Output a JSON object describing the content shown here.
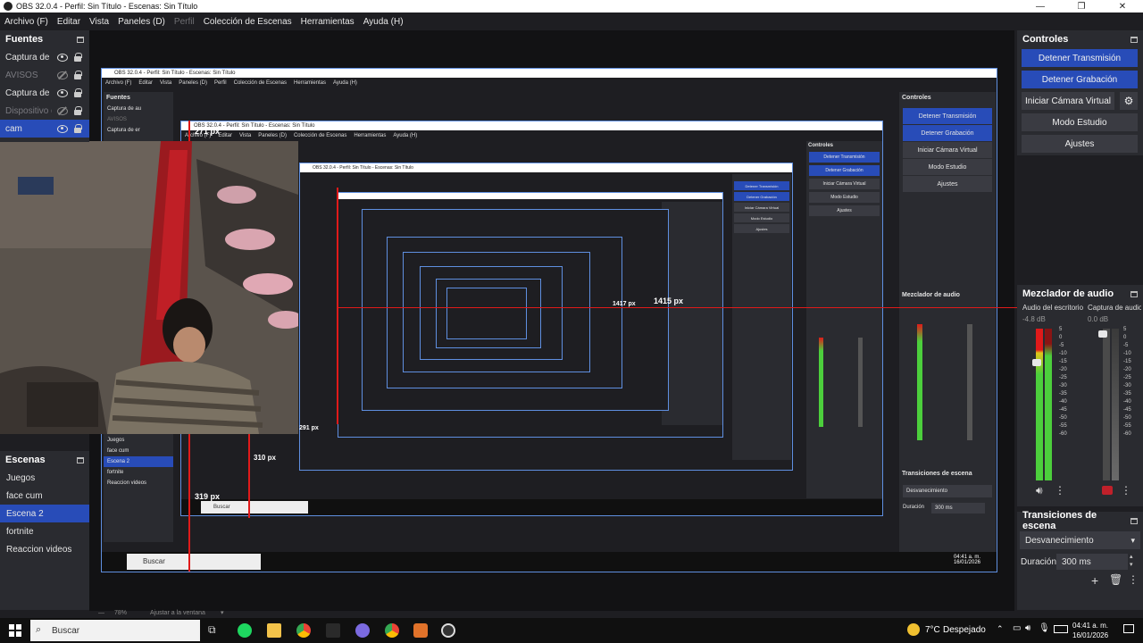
{
  "window": {
    "title": "OBS 32.0.4 - Perfil: Sin Título - Escenas: Sin Título",
    "ctrl_min": "—",
    "ctrl_max": "❐",
    "ctrl_close": "✕"
  },
  "menu": {
    "items": [
      "Archivo (F)",
      "Editar",
      "Vista",
      "Paneles (D)",
      "Perfil",
      "Colección de Escenas",
      "Herramientas",
      "Ayuda (H)"
    ]
  },
  "sources": {
    "title": "Fuentes",
    "items": [
      {
        "label": "Captura de au",
        "visible": true,
        "selected": false
      },
      {
        "label": "AVISOS",
        "visible": false,
        "selected": false
      },
      {
        "label": "Captura de er",
        "visible": true,
        "selected": false
      },
      {
        "label": "Dispositivo de",
        "visible": false,
        "selected": false
      },
      {
        "label": "cam",
        "visible": true,
        "selected": true
      }
    ]
  },
  "scenes": {
    "title": "Escenas",
    "items": [
      "Juegos",
      "face cum",
      "Escena 2",
      "fortnite",
      "Reaccion videos"
    ],
    "selected": "Escena 2"
  },
  "controls": {
    "title": "Controles",
    "stop_stream": "Detener Transmisión",
    "stop_record": "Detener Grabación",
    "virtual_cam": "Iniciar Cámara Virtual",
    "studio_mode": "Modo Estudio",
    "settings": "Ajustes"
  },
  "mixer": {
    "title": "Mezclador de audio",
    "channels": [
      {
        "name": "Audio del escritorio",
        "db": "-4.8 dB",
        "level": 0.82
      },
      {
        "name": "Captura de audio",
        "db": "0.0 dB",
        "level": 0.0
      }
    ],
    "scale": [
      "5",
      "0",
      "-5",
      "-10",
      "-15",
      "-20",
      "-25",
      "-30",
      "-35",
      "-40",
      "-45",
      "-50",
      "-55",
      "-60"
    ]
  },
  "transitions": {
    "title": "Transiciones de escena",
    "selected": "Desvanecimiento",
    "duration_label": "Duración",
    "duration_value": "300 ms"
  },
  "preview": {
    "zoom": "78%",
    "fit": "Ajustar a la ventana",
    "measure_labels": [
      "1415 px",
      "1417 px",
      "319 px",
      "310 px",
      "271 px",
      "291 px"
    ]
  },
  "taskbar": {
    "search_placeholder": "Buscar",
    "weather": "7°C",
    "weather_text": "Despejado",
    "time": "04:41 a. m.",
    "date": "16/01/2026"
  },
  "nested_labels": {
    "title": "OBS 32.0.4 - Perfil: Sin Título - Escenas: Sin Título",
    "sources_title": "Fuentes",
    "mixer_title": "Mezclador de audio",
    "transitions_title": "Transiciones de escena",
    "controls_title": "Controles"
  },
  "colors": {
    "accent": "#284cb8",
    "meter_green": "#4ccf3c",
    "meter_red": "#e01a1a",
    "bg": "#1e1e22",
    "panel": "#2a2b30"
  }
}
